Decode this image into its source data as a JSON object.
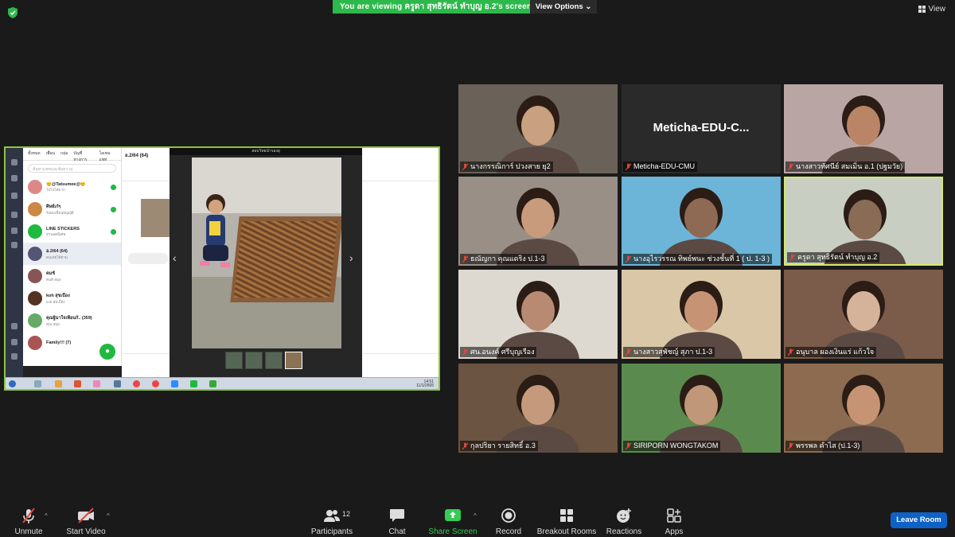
{
  "banner": {
    "text": "You are viewing ครูดา สุทธิรัตน์ ทำบุญ อ.2's screen"
  },
  "view_options": {
    "label": "View Options ⌄"
  },
  "view": {
    "label": "View"
  },
  "shared_screen": {
    "viewer_title": "สอบวิทยนำรองยุ",
    "chat_title": "อ.2/64 (64)",
    "chat_tabs": [
      "ทั้งหมด",
      "เพื่อน",
      "กลุ่ม",
      "บัญชีทางการ",
      "โอเพนแชท"
    ],
    "search_placeholder": "ค้นหาแชทและข้อความ",
    "chats": [
      {
        "name": "😊@Tatsumee@😊",
        "sub": "ไม่ไปได้มาก",
        "color": "#d88"
      },
      {
        "name": "ศิษย์เก๋ๆ",
        "sub": "รับผมเพื่อนบัญญัติ",
        "color": "#c84"
      },
      {
        "name": "LINE STICKERS",
        "sub": "ส่วนลดพิเศษ",
        "color": "#1fb940"
      },
      {
        "name": "อ.2/64 (64)",
        "sub": "คนเคยได้ตาม",
        "color": "#557"
      },
      {
        "name": "คมช์",
        "sub": "คนดี สมุย",
        "color": "#855"
      },
      {
        "name": "koh สุขเบื้อง",
        "sub": "kob สุขเบื้อง",
        "color": "#532"
      },
      {
        "name": "คุณฐิมาใจเพื่อนกั.. (359)",
        "sub": "คุณ สมุย",
        "color": "#6a6"
      },
      {
        "name": "Family!!! (7)",
        "sub": "",
        "color": "#a55"
      }
    ],
    "clock_time": "14:51",
    "clock_date": "11/1/2565"
  },
  "participants": [
    {
      "name": "นางกรรณิการ์ ปวงสาย ยุ2",
      "bg": "#6a6258",
      "face": "#c9a080"
    },
    {
      "name": "Meticha-EDU-CMU",
      "big": "Meticha-EDU-C...",
      "bg": "#2a2a2a"
    },
    {
      "name": "นางสาวทัศนีย์ สมเมิ่น อ.1 (ปฐมวัย)",
      "bg": "#b9a6a4",
      "face": "#b98566"
    },
    {
      "name": "ธณัญกา คุณแดริง ป.1-3",
      "bg": "#9a8f86",
      "face": "#c79b7c"
    },
    {
      "name": "นางอุไรวรรณ ทิพย์พนะ ช่วงชั้นที่ 1 ( ป. 1-3 )",
      "bg": "#6cb5d8",
      "face": "#8e6a55"
    },
    {
      "name": "ครูดา สุทธิรัตน์ ทำบุญ อ.2",
      "bg": "#c8cfc2",
      "face": "#8a6b55"
    },
    {
      "name": "ศน.อนงค์ ศรีบุญเรือง",
      "bg": "#ddd8d0",
      "face": "#b88a72"
    },
    {
      "name": "นางสาวสุพัชญ์ สุภา ป.1-3",
      "bg": "#d9c7a8",
      "face": "#c69474"
    },
    {
      "name": "อนุบาล ผองเงินแร่ แก้วใจ",
      "bg": "#7b5c4a",
      "face": "#d5b29a"
    },
    {
      "name": "กุลปริยา รายสิทธิ์ อ.3",
      "bg": "#6b5442",
      "face": "#c59a7c"
    },
    {
      "name": "SIRIPORN WONGTAKOM",
      "bg": "#5b8a4f",
      "face": "#c09778"
    },
    {
      "name": "พรรพล คำไส (ป.1-3)",
      "bg": "#8d6b50",
      "face": "#c69474"
    }
  ],
  "toolbar": {
    "unmute": "Unmute",
    "start_video": "Start Video",
    "participants": "Participants",
    "participants_count": "12",
    "chat": "Chat",
    "share_screen": "Share Screen",
    "record": "Record",
    "breakout_rooms": "Breakout Rooms",
    "reactions": "Reactions",
    "apps": "Apps",
    "leave_room": "Leave Room"
  },
  "colors": {
    "share_green": "#2db84b",
    "active_border": "#d4e86a",
    "leave_blue": "#0e62c7",
    "mic_red": "#e0463a"
  }
}
